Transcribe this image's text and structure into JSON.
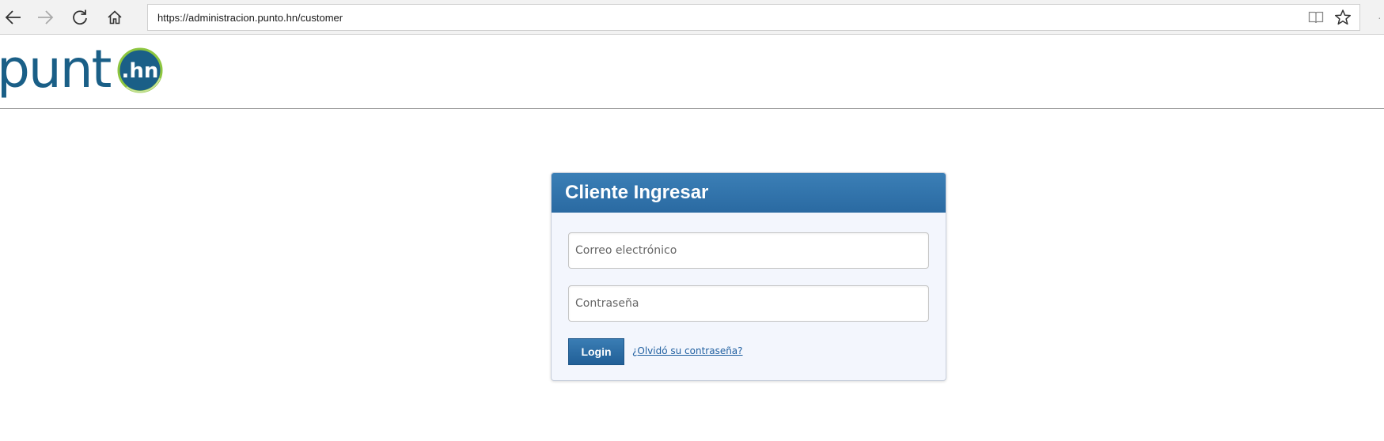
{
  "browser": {
    "url": "https://administracion.punto.hn/customer",
    "nav_icons": [
      "back-arrow-icon",
      "forward-arrow-icon",
      "refresh-icon",
      "home-icon"
    ],
    "address_icons": [
      "reading-view-icon",
      "favorite-star-icon"
    ]
  },
  "logo": {
    "word": "punt",
    "badge": ".hn",
    "colors": {
      "text": "#1a5f87",
      "badge_fill": "#1a5f87",
      "badge_ring": "#8dc63f"
    }
  },
  "login": {
    "title": "Cliente Ingresar",
    "email_placeholder": "Correo electrónico",
    "email_value": "",
    "password_placeholder": "Contraseña",
    "password_value": "",
    "login_label": "Login",
    "forgot_label": "¿Olvidó su contraseña?",
    "colors": {
      "header": "#2f73ab",
      "panel_bg": "#f3f6fd",
      "link": "#1f5fa0"
    }
  }
}
